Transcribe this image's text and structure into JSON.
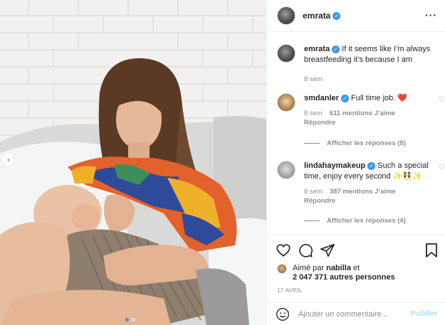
{
  "post": {
    "username": "emrata",
    "date": "17 AVRIL",
    "caption": {
      "username": "emrata",
      "text": "If it seems like I’m always breastfeeding it’s because I am",
      "time": "8 sem"
    }
  },
  "comments": [
    {
      "username": "smdanler",
      "text": "Full time job.",
      "emoji": "❤️",
      "time": "8 sem",
      "likes": "611 mentions J’aime",
      "reply": "Répondre",
      "show_replies": "Afficher les réponses (8)"
    },
    {
      "username": "lindahaymakeup",
      "text": "Such a special time, enjoy every second ✨👯✨",
      "time": "8 sem",
      "likes": "387 mentions J’aime",
      "reply": "Répondre",
      "show_replies": "Afficher les réponses (4)"
    }
  ],
  "likes": {
    "prefix": "Aimé par",
    "user": "nabilla",
    "conj": "et",
    "count": "2 047 371 autres personnes"
  },
  "composer": {
    "placeholder": "Ajouter un commentaire...",
    "publish": "Publier"
  },
  "icons": {
    "more": "more-options-icon",
    "like": "heart-outline-icon",
    "comment": "comment-bubble-icon",
    "share": "paper-plane-icon",
    "save": "bookmark-icon",
    "emoji": "smiley-icon",
    "verified": "verified-badge-icon",
    "prev": "chevron-left-icon"
  },
  "colors": {
    "accent": "#3897f0",
    "heart": "#ed4956",
    "muted": "#8e8e8e",
    "publish_disabled": "#b2dffc"
  },
  "carousel": {
    "slides": 2,
    "active": 1
  }
}
